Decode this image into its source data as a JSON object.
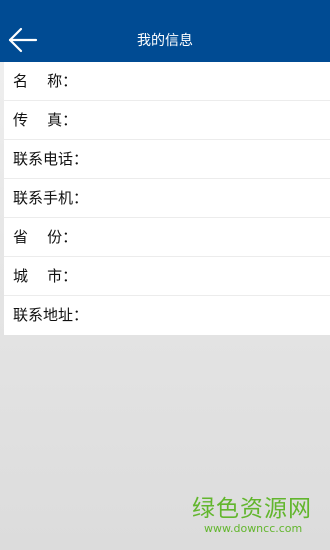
{
  "header": {
    "title": "我的信息",
    "back_icon": "arrow-left-icon",
    "background_color": "#004b93"
  },
  "form": {
    "fields": [
      {
        "label": "名    称：",
        "value": ""
      },
      {
        "label": "传    真：",
        "value": ""
      },
      {
        "label": "联系电话：",
        "value": ""
      },
      {
        "label": "联系手机：",
        "value": ""
      },
      {
        "label": "省    份：",
        "value": ""
      },
      {
        "label": "城    市：",
        "value": ""
      },
      {
        "label": "联系地址：",
        "value": ""
      }
    ]
  },
  "watermark": {
    "text": "绿色资源网",
    "url": "www.downcc.com",
    "color": "#62b62d"
  }
}
